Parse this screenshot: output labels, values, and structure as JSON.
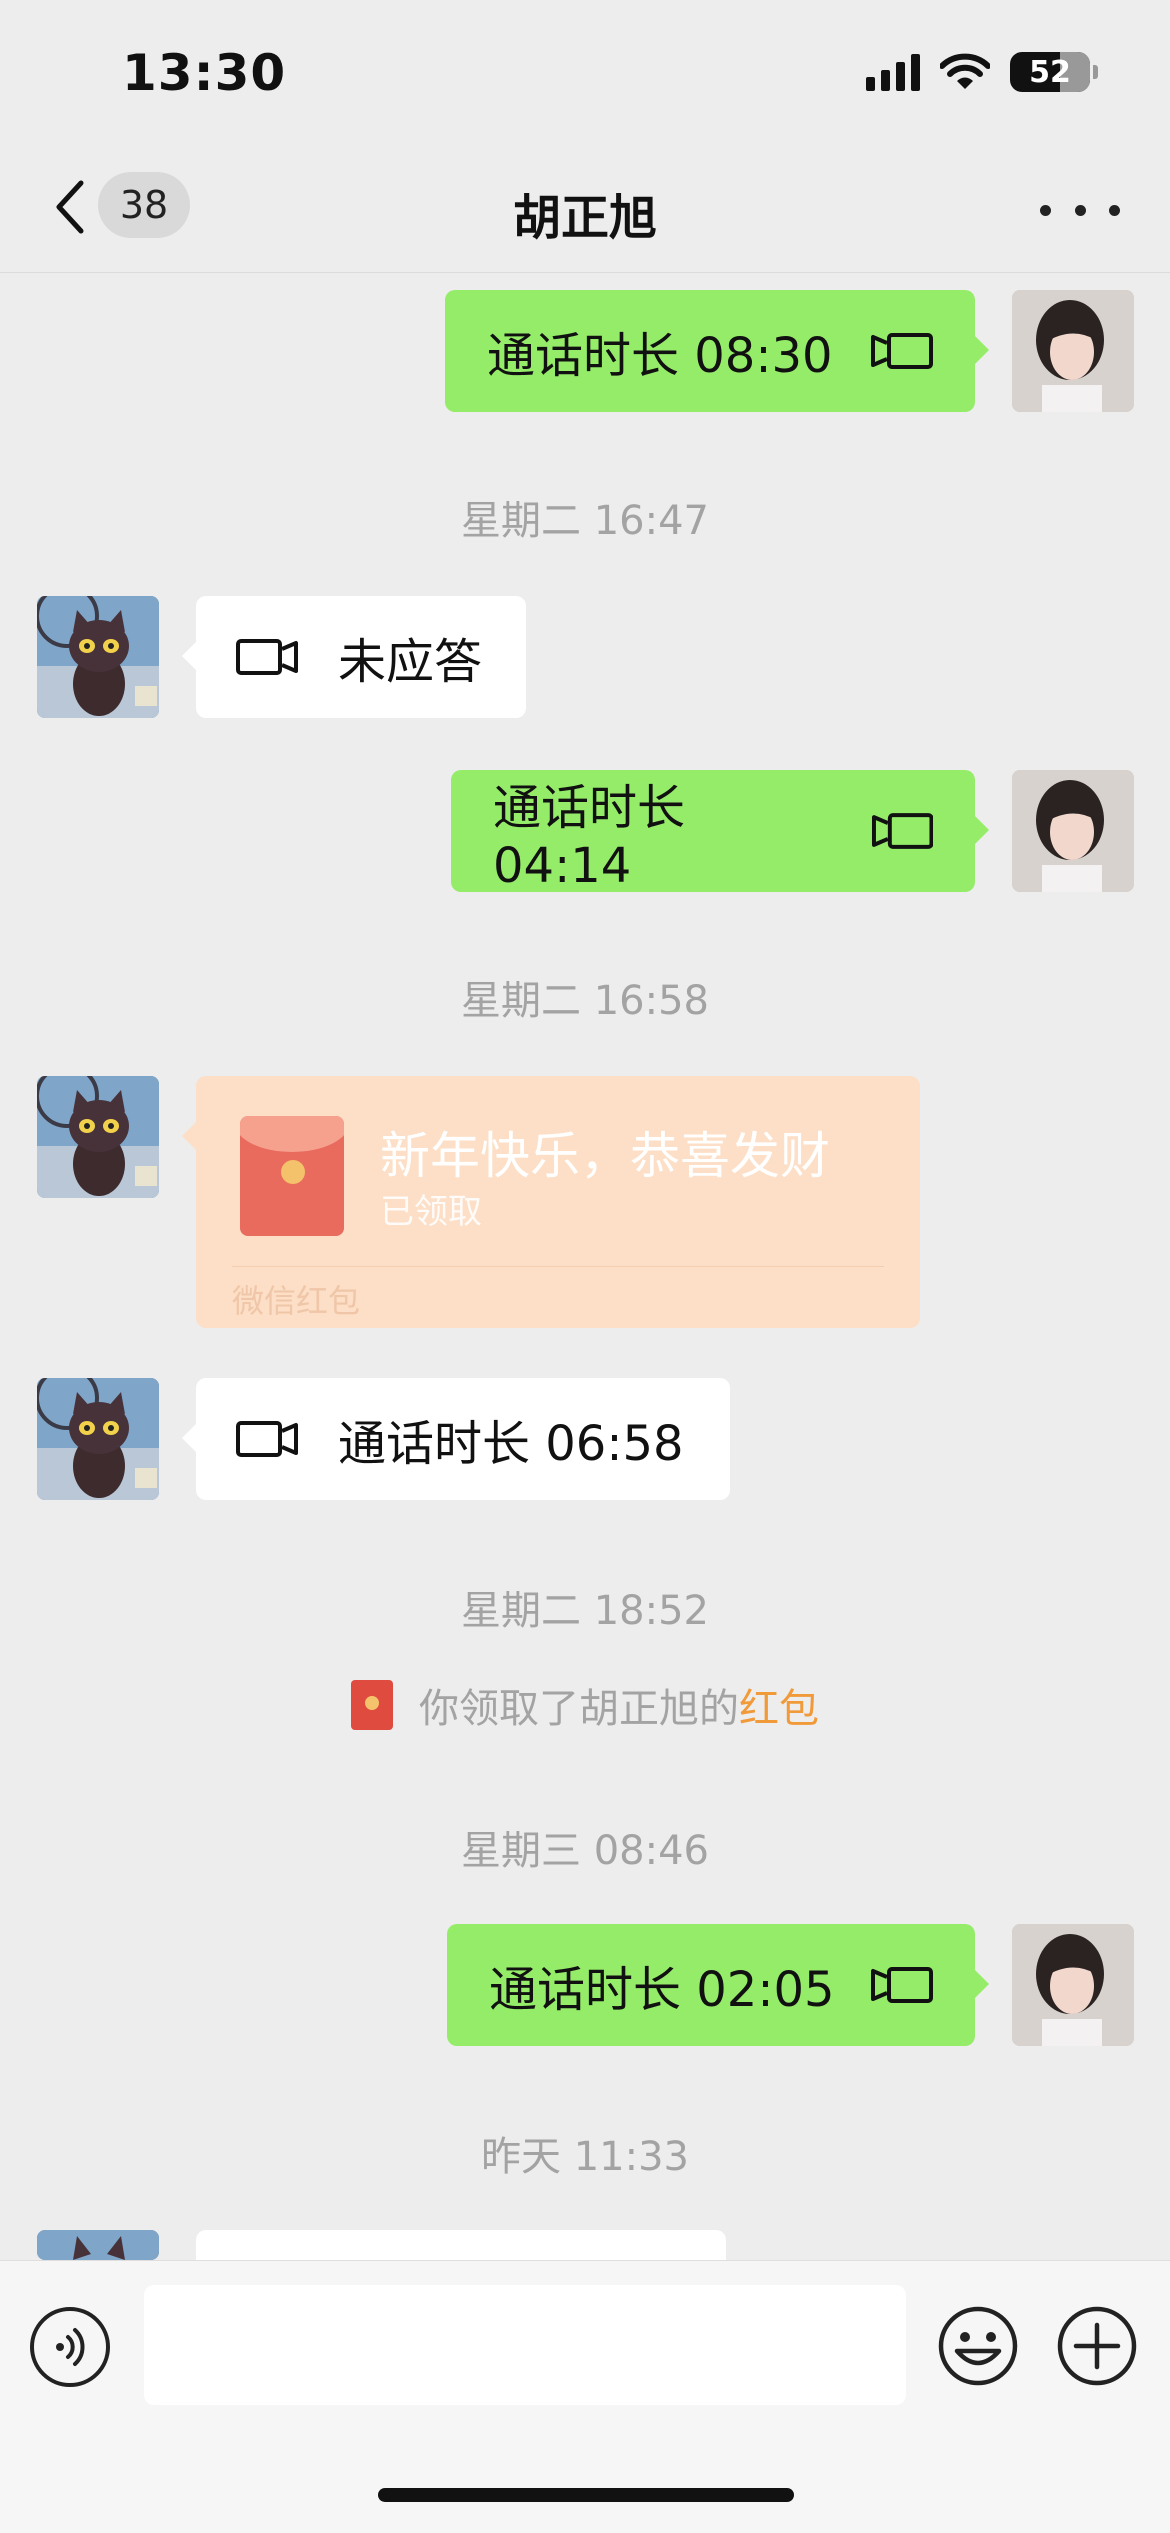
{
  "status_bar": {
    "time": "13:30",
    "battery": "52"
  },
  "nav": {
    "back_badge": "38",
    "title": "胡正旭"
  },
  "messages": [
    {
      "type": "call",
      "side": "out",
      "text": "通话时长 08:30"
    },
    {
      "type": "timestamp",
      "text": "星期二 16:47"
    },
    {
      "type": "call",
      "side": "in",
      "text": "未应答"
    },
    {
      "type": "call",
      "side": "out",
      "text": "通话时长 04:14"
    },
    {
      "type": "timestamp",
      "text": "星期二 16:58"
    },
    {
      "type": "red_packet",
      "side": "in",
      "title": "新年快乐，恭喜发财",
      "status": "已领取",
      "footer": "微信红包"
    },
    {
      "type": "call",
      "side": "in",
      "text": "通话时长 06:58"
    },
    {
      "type": "timestamp",
      "text": "星期二 18:52"
    },
    {
      "type": "system",
      "prefix": "你领取了胡正旭的",
      "link": "红包"
    },
    {
      "type": "timestamp",
      "text": "星期三 08:46"
    },
    {
      "type": "call",
      "side": "out",
      "text": "通话时长 02:05"
    },
    {
      "type": "timestamp",
      "text": "昨天 11:33"
    }
  ],
  "input_bar": {
    "placeholder": ""
  },
  "icons": {
    "back": "chevron-left-icon",
    "more": "more-horizontal-icon",
    "video_call": "video-camera-icon",
    "red_packet": "red-packet-icon",
    "voice": "voice-icon",
    "emoji": "smiley-icon",
    "plus": "plus-circle-icon"
  },
  "colors": {
    "outgoing_bubble": "#95ec69",
    "incoming_bubble": "#ffffff",
    "background": "#ededed",
    "red_packet_bg": "#fcdfc6",
    "link": "#f09a3a"
  }
}
